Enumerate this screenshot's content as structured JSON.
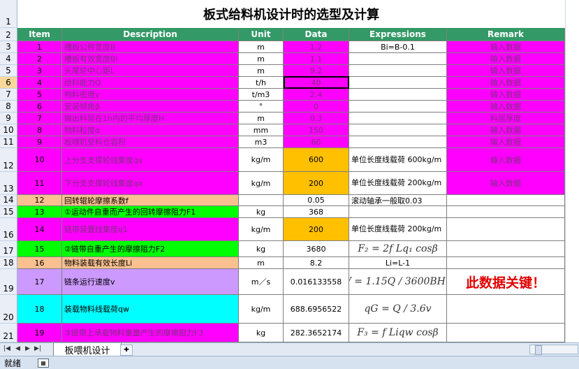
{
  "title": "板式给料机设计时的选型及计算",
  "row_numbers": [
    "1",
    "2",
    "3",
    "4",
    "5",
    "6",
    "7",
    "8",
    "9",
    "10",
    "11",
    "12",
    "13",
    "14",
    "15",
    "16",
    "17",
    "18",
    "19",
    "20",
    "21"
  ],
  "header": {
    "item": "Item",
    "description": "Description",
    "unit": "Unit",
    "data": "Data",
    "expressions": "Expressions",
    "remark": "Remark"
  },
  "rows": [
    {
      "item": "1",
      "desc": "槽板公称宽度B",
      "unit": "m",
      "data": "1.2",
      "expr": "Bi=B-0.1",
      "remark": "输入数据"
    },
    {
      "item": "2",
      "desc": "槽板有效宽度Bi",
      "unit": "m",
      "data": "1.1",
      "expr": "",
      "remark": "输入数据"
    },
    {
      "item": "3",
      "desc": "头尾轮中心距L",
      "unit": "m",
      "data": "9.2",
      "expr": "",
      "remark": "输入数据"
    },
    {
      "item": "4",
      "desc": "给料能力Q",
      "unit": "t/h",
      "data": "40",
      "expr": "",
      "remark": "输入数据"
    },
    {
      "item": "5",
      "desc": "物料密度γ",
      "unit": "t/m3",
      "data": "2.4",
      "expr": "",
      "remark": "输入数据"
    },
    {
      "item": "6",
      "desc": "安装倾角β",
      "unit": "°",
      "data": "0",
      "expr": "",
      "remark": "输入数据"
    },
    {
      "item": "7",
      "desc": "输出料层在1h内的平均厚度H",
      "unit": "m",
      "data": "0.3",
      "expr": "",
      "remark": "料层厚度"
    },
    {
      "item": "8",
      "desc": "物料粒度α",
      "unit": "mm",
      "data": "150",
      "expr": "",
      "remark": "输入数据"
    },
    {
      "item": "9",
      "desc": "板喂机受料仓容积",
      "unit": "m3",
      "data": "60",
      "expr": "",
      "remark": "输入数据"
    },
    {
      "item": "10",
      "desc": "上分支支撑轮线集度qs",
      "unit": "kg/m",
      "data": "600",
      "expr": "单位长度线载荷 600kg/m",
      "remark": "输入数据"
    },
    {
      "item": "11",
      "desc": "下分支支撑轮线集度qx",
      "unit": "kg/m",
      "data": "200",
      "expr": "单位长度线载荷 200kg/m",
      "remark": "输入数据"
    },
    {
      "item": "12",
      "desc": "回转辊轮摩擦系数f",
      "unit": "",
      "data": "0.05",
      "expr": "滚动轴承一般取0.03",
      "remark": ""
    },
    {
      "item": "13",
      "desc": "①运动件自重而产生的回转摩擦阻力F1",
      "unit": "kg",
      "data": "368",
      "expr": "",
      "remark": ""
    },
    {
      "item": "14",
      "desc": "链带装置线集度q1",
      "unit": "kg/m",
      "data": "200",
      "expr": "单位长度线载荷 200kg/m",
      "remark": ""
    },
    {
      "item": "15",
      "desc": "②链带自重产生的摩擦阻力F2",
      "unit": "kg",
      "data": "3680",
      "expr": "F₂ = 2f Lq₁ cosβ",
      "remark": ""
    },
    {
      "item": "16",
      "desc": "物料装载有效长度Li",
      "unit": "m",
      "data": "8.2",
      "expr": "Li=L-1",
      "remark": ""
    },
    {
      "item": "17",
      "desc": "链条运行速度v",
      "unit": "m／s",
      "data": "0.016133558",
      "expr": "V = 1.15Q / 3600BHγ",
      "remark": "此数据关键！"
    },
    {
      "item": "18",
      "desc": "装载物料线载荷qw",
      "unit": "kg/m",
      "data": "688.6956522",
      "expr": "qG = Q / 3.6v",
      "remark": ""
    },
    {
      "item": "19",
      "desc": "③链带上承载物料重量产生的摩擦阻力F3",
      "unit": "kg",
      "data": "282.3652174",
      "expr": "F₃ = f Liqw cosβ",
      "remark": ""
    }
  ],
  "sheet_tab": "板喂机设计",
  "status_text": "就绪"
}
